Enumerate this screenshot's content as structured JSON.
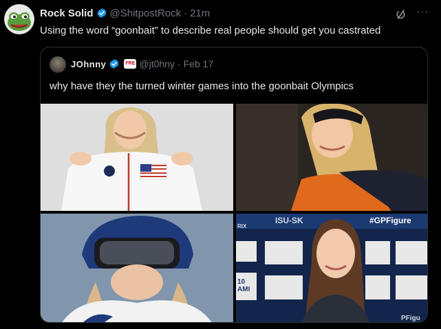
{
  "tweet": {
    "author_name": "Rock Solid",
    "author_handle": "@ShitpostRock",
    "separator": "·",
    "time": "21m",
    "text": "Using the word “goonbait” to describe real people should get you castrated",
    "more_label": "···"
  },
  "quoted_tweet": {
    "author_name": "JOhnny",
    "badge_text": "FRE",
    "author_handle": "@jt0hny",
    "separator": "·",
    "date": "Feb 17",
    "text": "why have they the turned winter games into the goonbait Olympics"
  },
  "photos": {
    "p4_sign_isu": "ISU-SK",
    "p4_sign_gp": "#GPFigure",
    "p4_sign_left_top": "RIX",
    "p4_sign_left_bottom": "10 AMI",
    "p4_sign_bottom": "PFigu"
  },
  "colors": {
    "background": "#000000",
    "text_primary": "#e7e9ea",
    "text_secondary": "#71767b",
    "verified_blue": "#1d9bf0",
    "border": "#2f3336"
  }
}
